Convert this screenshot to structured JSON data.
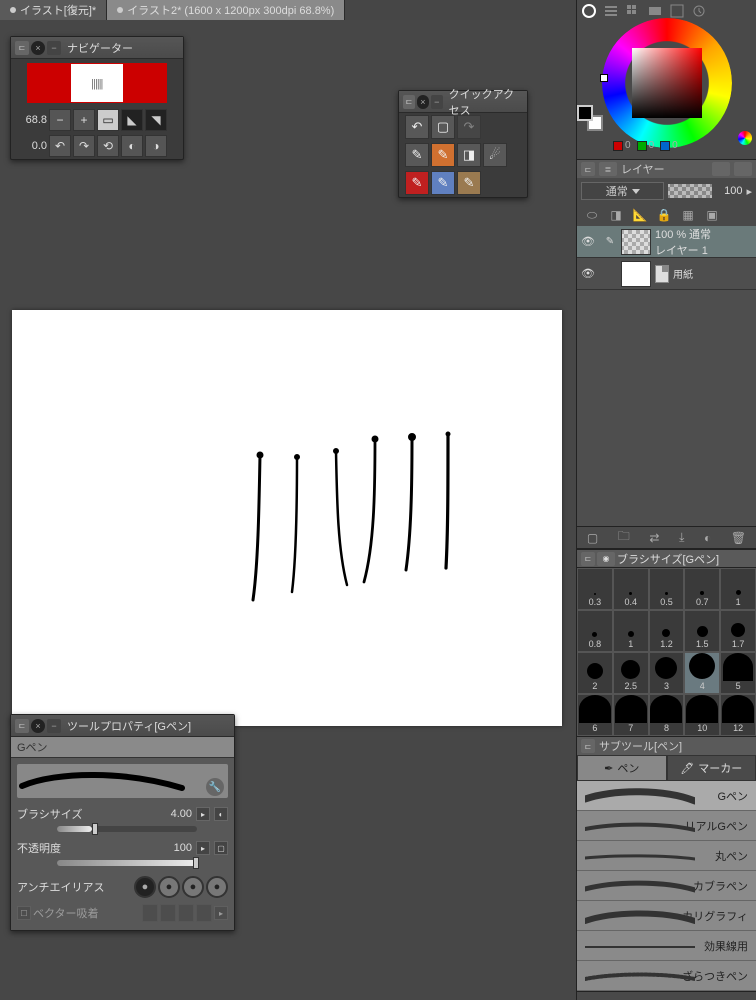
{
  "tabs": {
    "tab1": "イラスト[復元]*",
    "tab2": "イラスト2* (1600 x 1200px 300dpi 68.8%)"
  },
  "navigator": {
    "title": "ナビゲーター",
    "zoom": "68.8",
    "rotation": "0.0"
  },
  "quickaccess": {
    "title": "クイックアクセス"
  },
  "toolprop": {
    "title": "ツールプロパティ[Gペン]",
    "tool_name": "Gペン",
    "brush_size_label": "ブラシサイズ",
    "brush_size_value": "4.00",
    "opacity_label": "不透明度",
    "opacity_value": "100",
    "aa_label": "アンチエイリアス",
    "vector_label": "ベクター吸着"
  },
  "color": {
    "r": "0",
    "g": "0",
    "b": "0"
  },
  "layer": {
    "panel_title": "レイヤー",
    "blend_mode": "通常",
    "opacity": "100",
    "layer1_opacity": "100 %",
    "layer1_blend": "通常",
    "layer1_name": "レイヤー 1",
    "paper_name": "用紙"
  },
  "brushsize": {
    "title": "ブラシサイズ[Gペン]",
    "sizes": [
      "0.3",
      "0.4",
      "0.5",
      "0.7",
      "1",
      "0.8",
      "1",
      "1.2",
      "1.5",
      "1.7",
      "2",
      "2.5",
      "3",
      "4",
      "5",
      "6",
      "7",
      "8",
      "10",
      "12"
    ]
  },
  "subtool": {
    "title": "サブツール[ペン]",
    "tab_pen": "ペン",
    "tab_marker": "マーカー",
    "items": [
      "Gペン",
      "リアルGペン",
      "丸ペン",
      "カブラペン",
      "カリグラフィ",
      "効果線用",
      "ざらつきペン"
    ]
  }
}
